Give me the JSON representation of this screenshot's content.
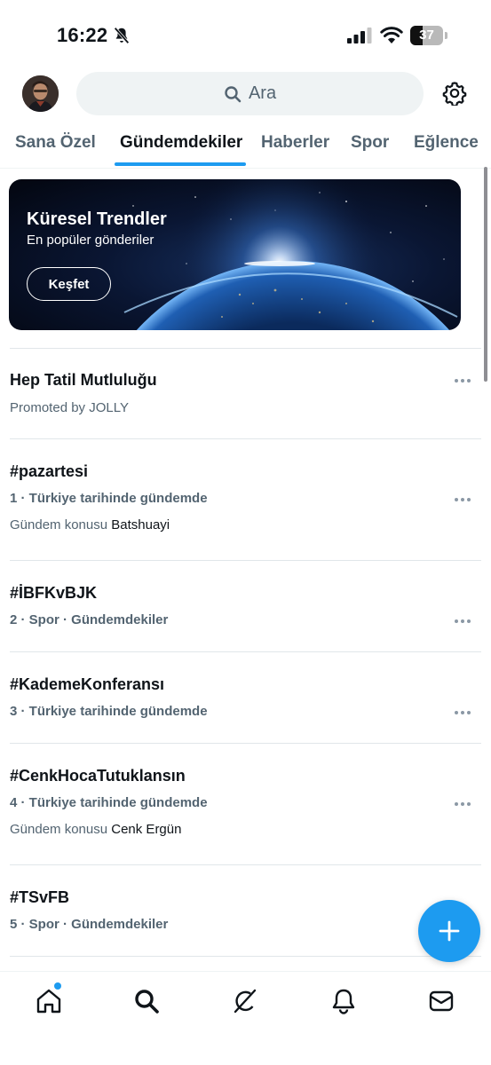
{
  "status_bar": {
    "time": "16:22",
    "battery": "37",
    "battery_level": 0.37
  },
  "top_bar": {
    "search_placeholder": "Ara"
  },
  "tabs": [
    {
      "label": "Sana Özel",
      "active": false
    },
    {
      "label": "Gündemdekiler",
      "active": true
    },
    {
      "label": "Haberler",
      "active": false
    },
    {
      "label": "Spor",
      "active": false
    },
    {
      "label": "Eğlence",
      "active": false
    }
  ],
  "banner": {
    "title": "Küresel Trendler",
    "subtitle": "En popüler gönderiler",
    "button_label": "Keşfet"
  },
  "trends": [
    {
      "title": "Hep Tatil Mutluluğu",
      "promoted": "Promoted by JOLLY"
    },
    {
      "title": "#pazartesi",
      "meta": "1 · Türkiye tarihinde gündemde",
      "sub_prefix": "Gündem konusu",
      "sub_name": "Batshuayi"
    },
    {
      "title": "#İBFKvBJK",
      "meta": "2 · Spor · Gündemdekiler"
    },
    {
      "title": "#KademeKonferansı",
      "meta": "3 · Türkiye tarihinde gündemde"
    },
    {
      "title": "#CenkHocaTutuklansın",
      "meta": "4 · Türkiye tarihinde gündemde",
      "sub_prefix": "Gündem konusu",
      "sub_name": "Cenk Ergün"
    },
    {
      "title": "#TSvFB",
      "meta": "5 · Spor · Gündemdekiler"
    }
  ],
  "colors": {
    "accent": "#1d9bf0",
    "text_primary": "#0f1419",
    "text_secondary": "#536471",
    "search_bg": "#eff3f4"
  },
  "icons": {
    "status": [
      "bell-slash-icon",
      "signal-icon",
      "wifi-icon",
      "battery-icon"
    ],
    "top": [
      "avatar",
      "search-icon",
      "gear-icon"
    ],
    "nav": [
      "home-icon",
      "search-icon",
      "grok-icon",
      "bell-icon",
      "mail-icon"
    ],
    "fab": "plus-icon",
    "row": "more-icon"
  }
}
